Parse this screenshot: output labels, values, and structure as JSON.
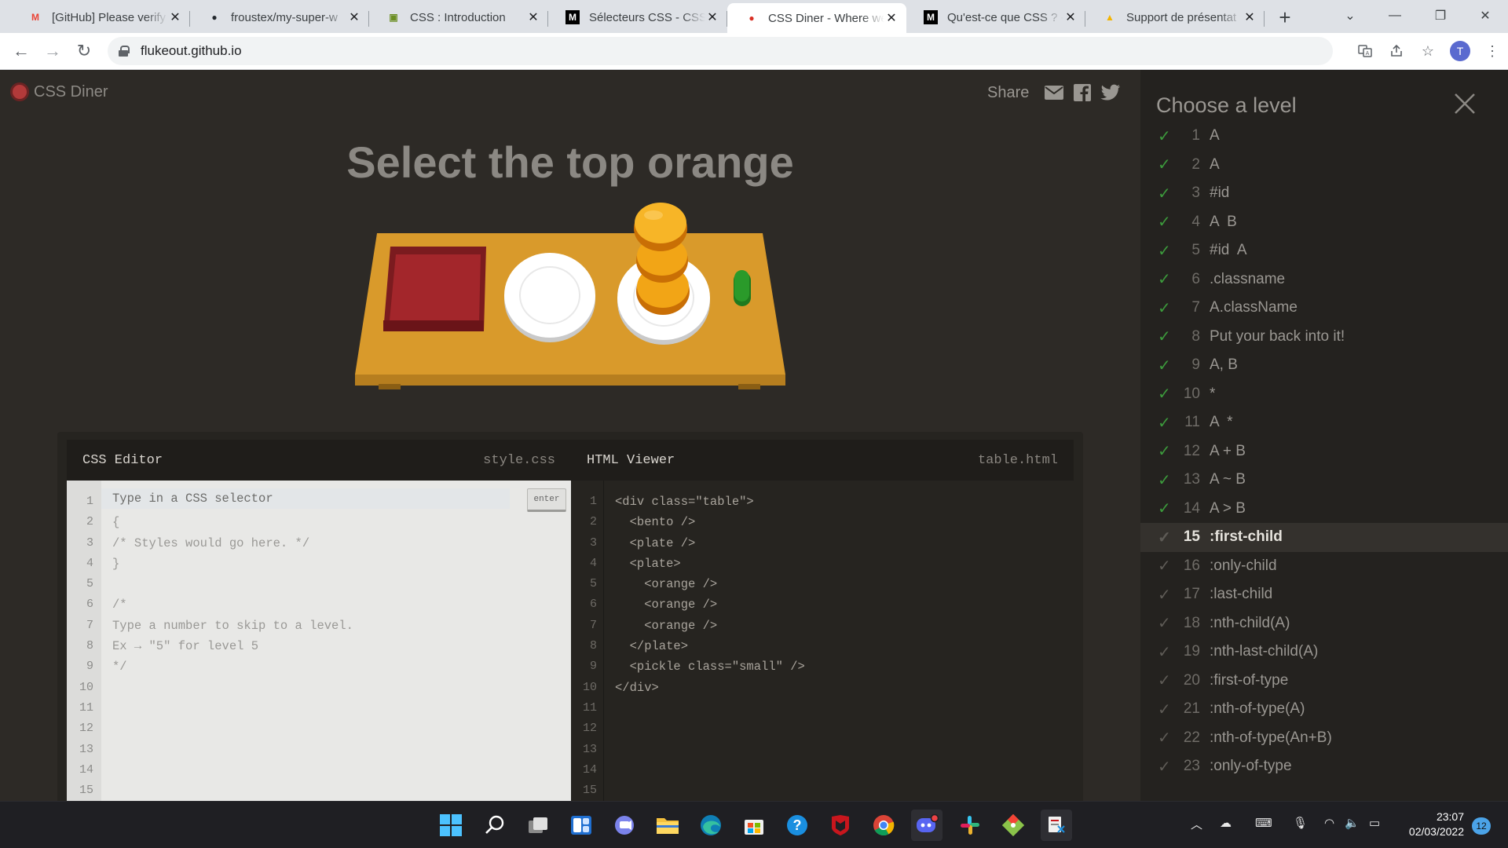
{
  "browser": {
    "tabs": [
      {
        "title": "[GitHub] Please verify",
        "icon": "gmail-icon"
      },
      {
        "title": "froustex/my-super-w",
        "icon": "github-icon"
      },
      {
        "title": "CSS : Introduction",
        "icon": "course-icon"
      },
      {
        "title": "Sélecteurs CSS - CSS",
        "icon": "mdn-icon"
      },
      {
        "title": "CSS Diner - Where we",
        "icon": "css-diner-icon",
        "active": true
      },
      {
        "title": "Qu'est-ce que CSS ? -",
        "icon": "mdn-icon"
      },
      {
        "title": "Support de présentat",
        "icon": "google-drive-icon"
      }
    ],
    "url": "flukeout.github.io",
    "profile_initial": "T"
  },
  "app": {
    "logo_text": "CSS Diner",
    "share_label": "Share",
    "instruction": "Select the top orange"
  },
  "css_editor": {
    "title": "CSS Editor",
    "filename": "style.css",
    "placeholder": "Type in a CSS selector",
    "enter_label": "enter",
    "lines": [
      "{",
      "/* Styles would go here. */",
      "}",
      "",
      "/*",
      "Type a number to skip to a level.",
      "Ex → \"5\" for level 5",
      "*/"
    ],
    "line_count": 15
  },
  "html_viewer": {
    "title": "HTML Viewer",
    "filename": "table.html",
    "lines": [
      "<div class=\"table\">",
      "  <bento />",
      "  <plate />",
      "  <plate>",
      "    <orange />",
      "    <orange />",
      "    <orange />",
      "  </plate>",
      "  <pickle class=\"small\" />",
      "</div>"
    ],
    "line_count": 15
  },
  "levels": {
    "title": "Choose a level",
    "current": 15,
    "items": [
      {
        "n": "1",
        "label": "A",
        "done": true
      },
      {
        "n": "2",
        "label": "A",
        "done": true
      },
      {
        "n": "3",
        "label": "#id",
        "done": true
      },
      {
        "n": "4",
        "label": "A  B",
        "done": true
      },
      {
        "n": "5",
        "label": "#id  A",
        "done": true
      },
      {
        "n": "6",
        "label": ".classname",
        "done": true
      },
      {
        "n": "7",
        "label": "A.className",
        "done": true
      },
      {
        "n": "8",
        "label": "Put your back into it!",
        "done": true
      },
      {
        "n": "9",
        "label": "A, B",
        "done": true
      },
      {
        "n": "10",
        "label": "*",
        "done": true
      },
      {
        "n": "11",
        "label": "A  *",
        "done": true
      },
      {
        "n": "12",
        "label": "A + B",
        "done": true
      },
      {
        "n": "13",
        "label": "A ~ B",
        "done": true
      },
      {
        "n": "14",
        "label": "A > B",
        "done": true
      },
      {
        "n": "15",
        "label": ":first-child",
        "done": false
      },
      {
        "n": "16",
        "label": ":only-child",
        "done": false
      },
      {
        "n": "17",
        "label": ":last-child",
        "done": false
      },
      {
        "n": "18",
        "label": ":nth-child(A)",
        "done": false
      },
      {
        "n": "19",
        "label": ":nth-last-child(A)",
        "done": false
      },
      {
        "n": "20",
        "label": ":first-of-type",
        "done": false
      },
      {
        "n": "21",
        "label": ":nth-of-type(A)",
        "done": false
      },
      {
        "n": "22",
        "label": ":nth-of-type(An+B)",
        "done": false
      },
      {
        "n": "23",
        "label": ":only-of-type",
        "done": false
      }
    ]
  },
  "taskbar": {
    "time": "23:07",
    "date": "02/03/2022",
    "notifications": "12"
  },
  "colors": {
    "background": "#2d2a26",
    "table": "#d99a2b",
    "orange": "#f2a516",
    "bento": "#a3262b",
    "pickle": "#2a9a2a",
    "check": "#3c9a3c"
  }
}
